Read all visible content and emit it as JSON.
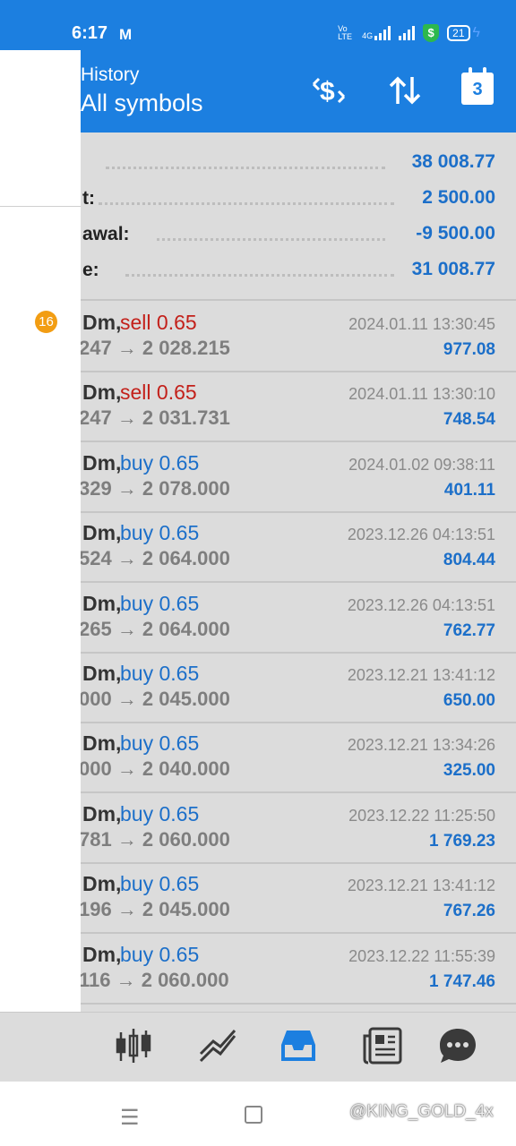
{
  "status_bar": {
    "time": "6:17",
    "mail_icon": "M",
    "network_label": "Vo LTE",
    "data_label": "4G",
    "battery": "21",
    "shield_icon": "$"
  },
  "header": {
    "title": "History",
    "subtitle": "All symbols",
    "calendar_day": "3",
    "icons": [
      "currency-exchange-icon",
      "sort-icon",
      "calendar-icon"
    ]
  },
  "summary": [
    {
      "label": "",
      "value": "38 008.77"
    },
    {
      "label": "t:",
      "value": "2 500.00"
    },
    {
      "label": "awal:",
      "value": "-9 500.00"
    },
    {
      "label": "e:",
      "value": "31 008.77"
    }
  ],
  "deals": [
    {
      "symbol": "Dm,",
      "type": "sell 0.65",
      "side": "sell",
      "prices": "247 → 2 028.215",
      "time": "2024.01.11 13:30:45",
      "profit": "977.08"
    },
    {
      "symbol": "Dm,",
      "type": "sell 0.65",
      "side": "sell",
      "prices": "247 → 2 031.731",
      "time": "2024.01.11 13:30:10",
      "profit": "748.54"
    },
    {
      "symbol": "Dm,",
      "type": "buy 0.65",
      "side": "buy",
      "prices": "329 → 2 078.000",
      "time": "2024.01.02 09:38:11",
      "profit": "401.11"
    },
    {
      "symbol": "Dm,",
      "type": "buy 0.65",
      "side": "buy",
      "prices": "524 → 2 064.000",
      "time": "2023.12.26 04:13:51",
      "profit": "804.44"
    },
    {
      "symbol": "Dm,",
      "type": "buy 0.65",
      "side": "buy",
      "prices": "265 → 2 064.000",
      "time": "2023.12.26 04:13:51",
      "profit": "762.77"
    },
    {
      "symbol": "Dm,",
      "type": "buy 0.65",
      "side": "buy",
      "prices": "000 → 2 045.000",
      "time": "2023.12.21 13:41:12",
      "profit": "650.00"
    },
    {
      "symbol": "Dm,",
      "type": "buy 0.65",
      "side": "buy",
      "prices": "000 → 2 040.000",
      "time": "2023.12.21 13:34:26",
      "profit": "325.00"
    },
    {
      "symbol": "Dm,",
      "type": "buy 0.65",
      "side": "buy",
      "prices": "781 → 2 060.000",
      "time": "2023.12.22 11:25:50",
      "profit": "1 769.23"
    },
    {
      "symbol": "Dm,",
      "type": "buy 0.65",
      "side": "buy",
      "prices": "196 → 2 045.000",
      "time": "2023.12.21 13:41:12",
      "profit": "767.26"
    },
    {
      "symbol": "Dm,",
      "type": "buy 0.65",
      "side": "buy",
      "prices": "116 → 2 060.000",
      "time": "2023.12.22 11:55:39",
      "profit": "1 747.46"
    }
  ],
  "drawer": {
    "badge_count": "16"
  },
  "bottom_nav": [
    "quotes-icon",
    "chart-icon",
    "history-icon",
    "news-icon",
    "chat-icon"
  ],
  "system_nav": {
    "menu_glyph": "☰",
    "watermark": "@KING_GOLD_4x"
  },
  "colors": {
    "accent": "#1c7fe0",
    "profit_blue": "#1c6fc9",
    "sell_red": "#c3201a",
    "badge": "#f29d13"
  }
}
